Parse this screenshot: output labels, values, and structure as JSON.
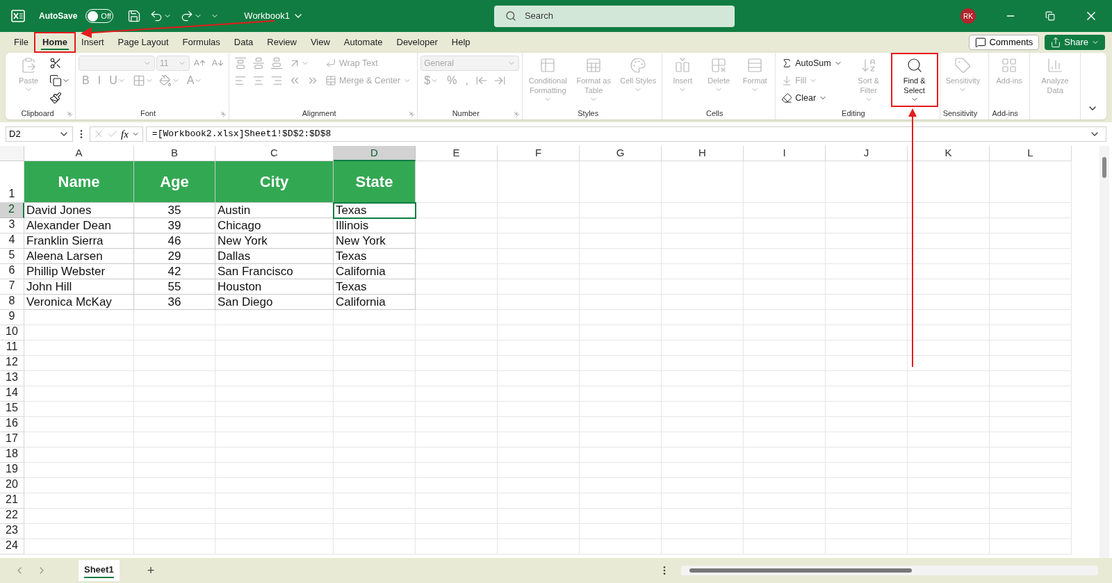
{
  "title_bar": {
    "autosave_label": "AutoSave",
    "autosave_toggle": {
      "label": "Off",
      "on": false
    },
    "workbook": "Workbook1",
    "search": {
      "placeholder": "Search"
    },
    "avatar": "RK"
  },
  "tabs": [
    {
      "label": "File",
      "selected": false,
      "highlighted": false
    },
    {
      "label": "Home",
      "selected": true,
      "highlighted": true
    },
    {
      "label": "Insert",
      "selected": false,
      "highlighted": false
    },
    {
      "label": "Page Layout",
      "selected": false,
      "highlighted": false
    },
    {
      "label": "Formulas",
      "selected": false,
      "highlighted": false
    },
    {
      "label": "Data",
      "selected": false,
      "highlighted": false
    },
    {
      "label": "Review",
      "selected": false,
      "highlighted": false
    },
    {
      "label": "View",
      "selected": false,
      "highlighted": false
    },
    {
      "label": "Automate",
      "selected": false,
      "highlighted": false
    },
    {
      "label": "Developer",
      "selected": false,
      "highlighted": false
    },
    {
      "label": "Help",
      "selected": false,
      "highlighted": false
    }
  ],
  "comments_button": "Comments",
  "share_button": "Share",
  "ribbon": [
    {
      "name": "Clipboard",
      "launcher": true,
      "columns": [
        [
          [
            {
              "kind": "large",
              "label": "Paste",
              "disabled": true,
              "dropdown": true,
              "highlighted": false
            }
          ]
        ],
        [
          [
            {
              "kind": "icon",
              "disabled": false,
              "dropdown": false
            }
          ],
          [
            {
              "kind": "icon",
              "disabled": false,
              "dropdown": true
            }
          ],
          [
            {
              "kind": "icon",
              "disabled": false,
              "dropdown": false
            }
          ]
        ]
      ]
    },
    {
      "name": "Font",
      "launcher": true,
      "columns": [
        [
          [
            {
              "kind": "combo",
              "disabled": true
            },
            {
              "kind": "combo",
              "value": "11",
              "disabled": true
            },
            {
              "kind": "icon",
              "disabled": true,
              "dropdown": false
            },
            {
              "kind": "icon",
              "disabled": true,
              "dropdown": false
            }
          ],
          [
            {
              "kind": "glyph",
              "label": "B",
              "disabled": true,
              "dropdown": false
            },
            {
              "kind": "glyph",
              "label": "I",
              "disabled": true,
              "dropdown": false
            },
            {
              "kind": "glyph",
              "label": "U",
              "disabled": true,
              "dropdown": true
            },
            {
              "kind": "icon",
              "disabled": true,
              "dropdown": true
            },
            {
              "kind": "icon",
              "disabled": true,
              "dropdown": true
            },
            {
              "kind": "glyph",
              "label": "A",
              "disabled": true,
              "dropdown": true
            }
          ]
        ]
      ]
    },
    {
      "name": "Alignment",
      "launcher": true,
      "columns": [
        [
          [
            {
              "kind": "icon",
              "disabled": true,
              "dropdown": false
            },
            {
              "kind": "icon",
              "disabled": true,
              "dropdown": false
            },
            {
              "kind": "icon",
              "disabled": true,
              "dropdown": false
            },
            {
              "kind": "icon",
              "disabled": true,
              "dropdown": true
            }
          ],
          [
            {
              "kind": "icon",
              "disabled": true,
              "dropdown": false
            },
            {
              "kind": "icon",
              "disabled": true,
              "dropdown": false
            },
            {
              "kind": "icon",
              "disabled": true,
              "dropdown": false
            },
            {
              "kind": "icon",
              "disabled": true,
              "dropdown": false
            },
            {
              "kind": "icon",
              "disabled": true,
              "dropdown": false
            }
          ]
        ],
        [
          [
            {
              "kind": "small",
              "label": "Wrap Text",
              "disabled": true,
              "dropdown": false
            }
          ],
          [
            {
              "kind": "small",
              "label": "Merge & Center",
              "disabled": true,
              "dropdown": true
            }
          ]
        ]
      ]
    },
    {
      "name": "Number",
      "launcher": true,
      "columns": [
        [
          [
            {
              "kind": "combo",
              "value": "General",
              "disabled": true
            }
          ],
          [
            {
              "kind": "glyph",
              "label": "$",
              "disabled": true,
              "dropdown": true
            },
            {
              "kind": "glyph",
              "label": "%",
              "disabled": true,
              "dropdown": false
            },
            {
              "kind": "glyph",
              "label": ",",
              "disabled": true,
              "dropdown": false
            },
            {
              "kind": "icon",
              "disabled": true,
              "dropdown": false
            },
            {
              "kind": "icon",
              "disabled": true,
              "dropdown": false
            }
          ]
        ]
      ]
    },
    {
      "name": "Styles",
      "columns": [
        [
          [
            {
              "kind": "large",
              "label": "Conditional Formatting",
              "disabled": true,
              "dropdown": true,
              "highlighted": false
            }
          ]
        ],
        [
          [
            {
              "kind": "large",
              "label": "Format as Table",
              "disabled": true,
              "dropdown": true,
              "highlighted": false
            }
          ]
        ],
        [
          [
            {
              "kind": "large",
              "label": "Cell Styles",
              "disabled": true,
              "dropdown": true,
              "highlighted": false
            }
          ]
        ]
      ]
    },
    {
      "name": "Cells",
      "columns": [
        [
          [
            {
              "kind": "large",
              "label": "Insert",
              "disabled": true,
              "dropdown": true,
              "highlighted": false
            }
          ]
        ],
        [
          [
            {
              "kind": "large",
              "label": "Delete",
              "disabled": true,
              "dropdown": true,
              "highlighted": false
            }
          ]
        ],
        [
          [
            {
              "kind": "large",
              "label": "Format",
              "disabled": true,
              "dropdown": true,
              "highlighted": false
            }
          ]
        ]
      ]
    },
    {
      "name": "Editing",
      "columns": [
        [
          [
            {
              "kind": "small",
              "label": "AutoSum",
              "disabled": false,
              "dropdown": true
            }
          ],
          [
            {
              "kind": "small",
              "label": "Fill",
              "disabled": true,
              "dropdown": true
            }
          ],
          [
            {
              "kind": "small",
              "label": "Clear",
              "disabled": false,
              "dropdown": true
            }
          ]
        ],
        [
          [
            {
              "kind": "large",
              "label": "Sort & Filter",
              "disabled": true,
              "dropdown": true,
              "highlighted": false
            }
          ]
        ],
        [
          [
            {
              "kind": "large",
              "label": "Find & Select",
              "disabled": false,
              "dropdown": true,
              "highlighted": true
            }
          ]
        ]
      ]
    },
    {
      "name": "Sensitivity",
      "columns": [
        [
          [
            {
              "kind": "large",
              "label": "Sensitivity",
              "disabled": true,
              "dropdown": true,
              "highlighted": false
            }
          ]
        ]
      ]
    },
    {
      "name": "Add-ins",
      "columns": [
        [
          [
            {
              "kind": "large",
              "label": "Add-ins",
              "disabled": true,
              "dropdown": false,
              "highlighted": false
            }
          ]
        ]
      ]
    },
    {
      "columns": [
        [
          [
            {
              "kind": "large",
              "label": "Analyze Data",
              "disabled": true,
              "dropdown": false,
              "highlighted": false
            }
          ]
        ]
      ]
    }
  ],
  "formula_bar": {
    "name_box": "D2",
    "fx": "fx",
    "formula": "=[Workbook2.xlsx]Sheet1!$D$2:$D$8"
  },
  "sheet": {
    "columns": [
      {
        "label": "A",
        "selected": false
      },
      {
        "label": "B",
        "selected": false
      },
      {
        "label": "C",
        "selected": false
      },
      {
        "label": "D",
        "selected": true
      },
      {
        "label": "E",
        "selected": false
      },
      {
        "label": "F",
        "selected": false
      },
      {
        "label": "G",
        "selected": false
      },
      {
        "label": "H",
        "selected": false
      },
      {
        "label": "I",
        "selected": false
      },
      {
        "label": "J",
        "selected": false
      },
      {
        "label": "K",
        "selected": false
      },
      {
        "label": "L",
        "selected": false
      }
    ],
    "rows": [
      {
        "number": "1",
        "selected": false,
        "kind": "header",
        "cells": [
          {
            "text": "Name",
            "selected": false
          },
          {
            "text": "Age",
            "selected": false
          },
          {
            "text": "City",
            "selected": false
          },
          {
            "text": "State",
            "selected": false
          }
        ]
      },
      {
        "number": "2",
        "selected": true,
        "kind": "data",
        "cells": [
          {
            "text": "David Jones",
            "selected": false
          },
          {
            "text": "35",
            "selected": false
          },
          {
            "text": "Austin",
            "selected": false
          },
          {
            "text": "Texas",
            "selected": true
          }
        ]
      },
      {
        "number": "3",
        "selected": false,
        "kind": "data",
        "cells": [
          {
            "text": "Alexander Dean",
            "selected": false
          },
          {
            "text": "39",
            "selected": false
          },
          {
            "text": "Chicago",
            "selected": false
          },
          {
            "text": "Illinois",
            "selected": false
          }
        ]
      },
      {
        "number": "4",
        "selected": false,
        "kind": "data",
        "cells": [
          {
            "text": "Franklin Sierra",
            "selected": false
          },
          {
            "text": "46",
            "selected": false
          },
          {
            "text": "New York",
            "selected": false
          },
          {
            "text": "New York",
            "selected": false
          }
        ]
      },
      {
        "number": "5",
        "selected": false,
        "kind": "data",
        "cells": [
          {
            "text": "Aleena Larsen",
            "selected": false
          },
          {
            "text": "29",
            "selected": false
          },
          {
            "text": "Dallas",
            "selected": false
          },
          {
            "text": "Texas",
            "selected": false
          }
        ]
      },
      {
        "number": "6",
        "selected": false,
        "kind": "data",
        "cells": [
          {
            "text": "Phillip Webster",
            "selected": false
          },
          {
            "text": "42",
            "selected": false
          },
          {
            "text": "San Francisco",
            "selected": false
          },
          {
            "text": "California",
            "selected": false
          }
        ]
      },
      {
        "number": "7",
        "selected": false,
        "kind": "data",
        "cells": [
          {
            "text": "John Hill",
            "selected": false
          },
          {
            "text": "55",
            "selected": false
          },
          {
            "text": "Houston",
            "selected": false
          },
          {
            "text": "Texas",
            "selected": false
          }
        ]
      },
      {
        "number": "8",
        "selected": false,
        "kind": "data",
        "cells": [
          {
            "text": "Veronica McKay",
            "selected": false
          },
          {
            "text": "36",
            "selected": false
          },
          {
            "text": "San Diego",
            "selected": false
          },
          {
            "text": "California",
            "selected": false
          }
        ]
      },
      {
        "number": "9",
        "selected": false
      },
      {
        "number": "10",
        "selected": false
      },
      {
        "number": "11",
        "selected": false
      },
      {
        "number": "12",
        "selected": false
      },
      {
        "number": "13",
        "selected": false
      },
      {
        "number": "14",
        "selected": false
      },
      {
        "number": "15",
        "selected": false
      },
      {
        "number": "16",
        "selected": false
      },
      {
        "number": "17",
        "selected": false
      },
      {
        "number": "18",
        "selected": false
      },
      {
        "number": "19",
        "selected": false
      },
      {
        "number": "20",
        "selected": false
      },
      {
        "number": "21",
        "selected": false
      },
      {
        "number": "22",
        "selected": false
      },
      {
        "number": "23",
        "selected": false
      },
      {
        "number": "24",
        "selected": false
      }
    ]
  },
  "sheet_tabs": [
    {
      "label": "Sheet1",
      "selected": true
    }
  ],
  "add_sheet": "+"
}
